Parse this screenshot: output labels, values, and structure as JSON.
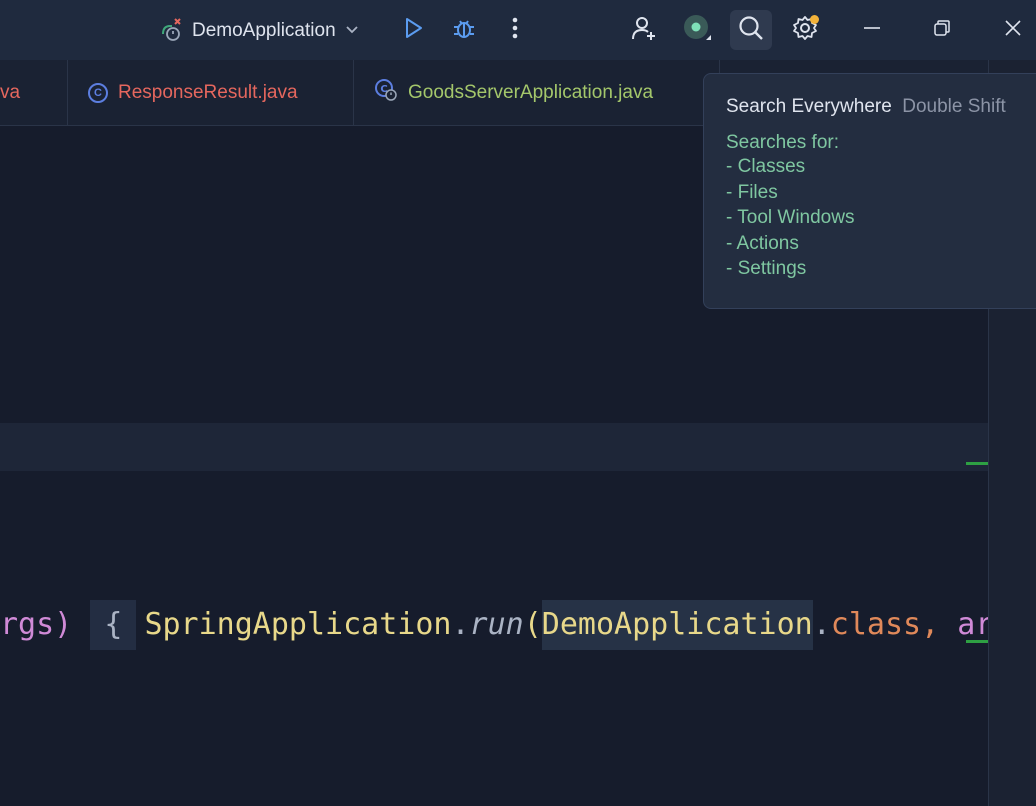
{
  "titlebar": {
    "run_config": "DemoApplication",
    "icons": [
      "run-config-icon",
      "chevron-down-icon",
      "run-icon",
      "debug-icon",
      "more-icon",
      "add-user-icon",
      "ai-assistant-icon",
      "search-icon",
      "settings-icon",
      "minimize-icon",
      "restore-icon",
      "close-icon"
    ]
  },
  "tabs": [
    {
      "label": "va",
      "color": "#e5675e"
    },
    {
      "label": "ResponseResult.java",
      "color": "#e5675e"
    },
    {
      "label": "GoodsServerApplication.java",
      "color": "#a4c76b"
    }
  ],
  "editor": {
    "code": {
      "t1": "rgs)",
      "t2": "{",
      "t3": "SpringApplication",
      "t4": ".",
      "t5": "run",
      "t6": "(",
      "t7": "DemoApplication",
      "t8": ".",
      "t9": "class",
      "t10": ", ",
      "t11": "arg"
    }
  },
  "tooltip": {
    "title": "Search Everywhere",
    "shortcut": "Double Shift",
    "subtitle": "Searches for:",
    "items": [
      "- Classes",
      "- Files",
      "- Tool Windows",
      "- Actions",
      "- Settings"
    ]
  },
  "colors": {
    "background": "#161c2c",
    "titlebar": "#1f2a3e",
    "accent_green": "#7fc7a1",
    "badge": "#f2b23a"
  }
}
